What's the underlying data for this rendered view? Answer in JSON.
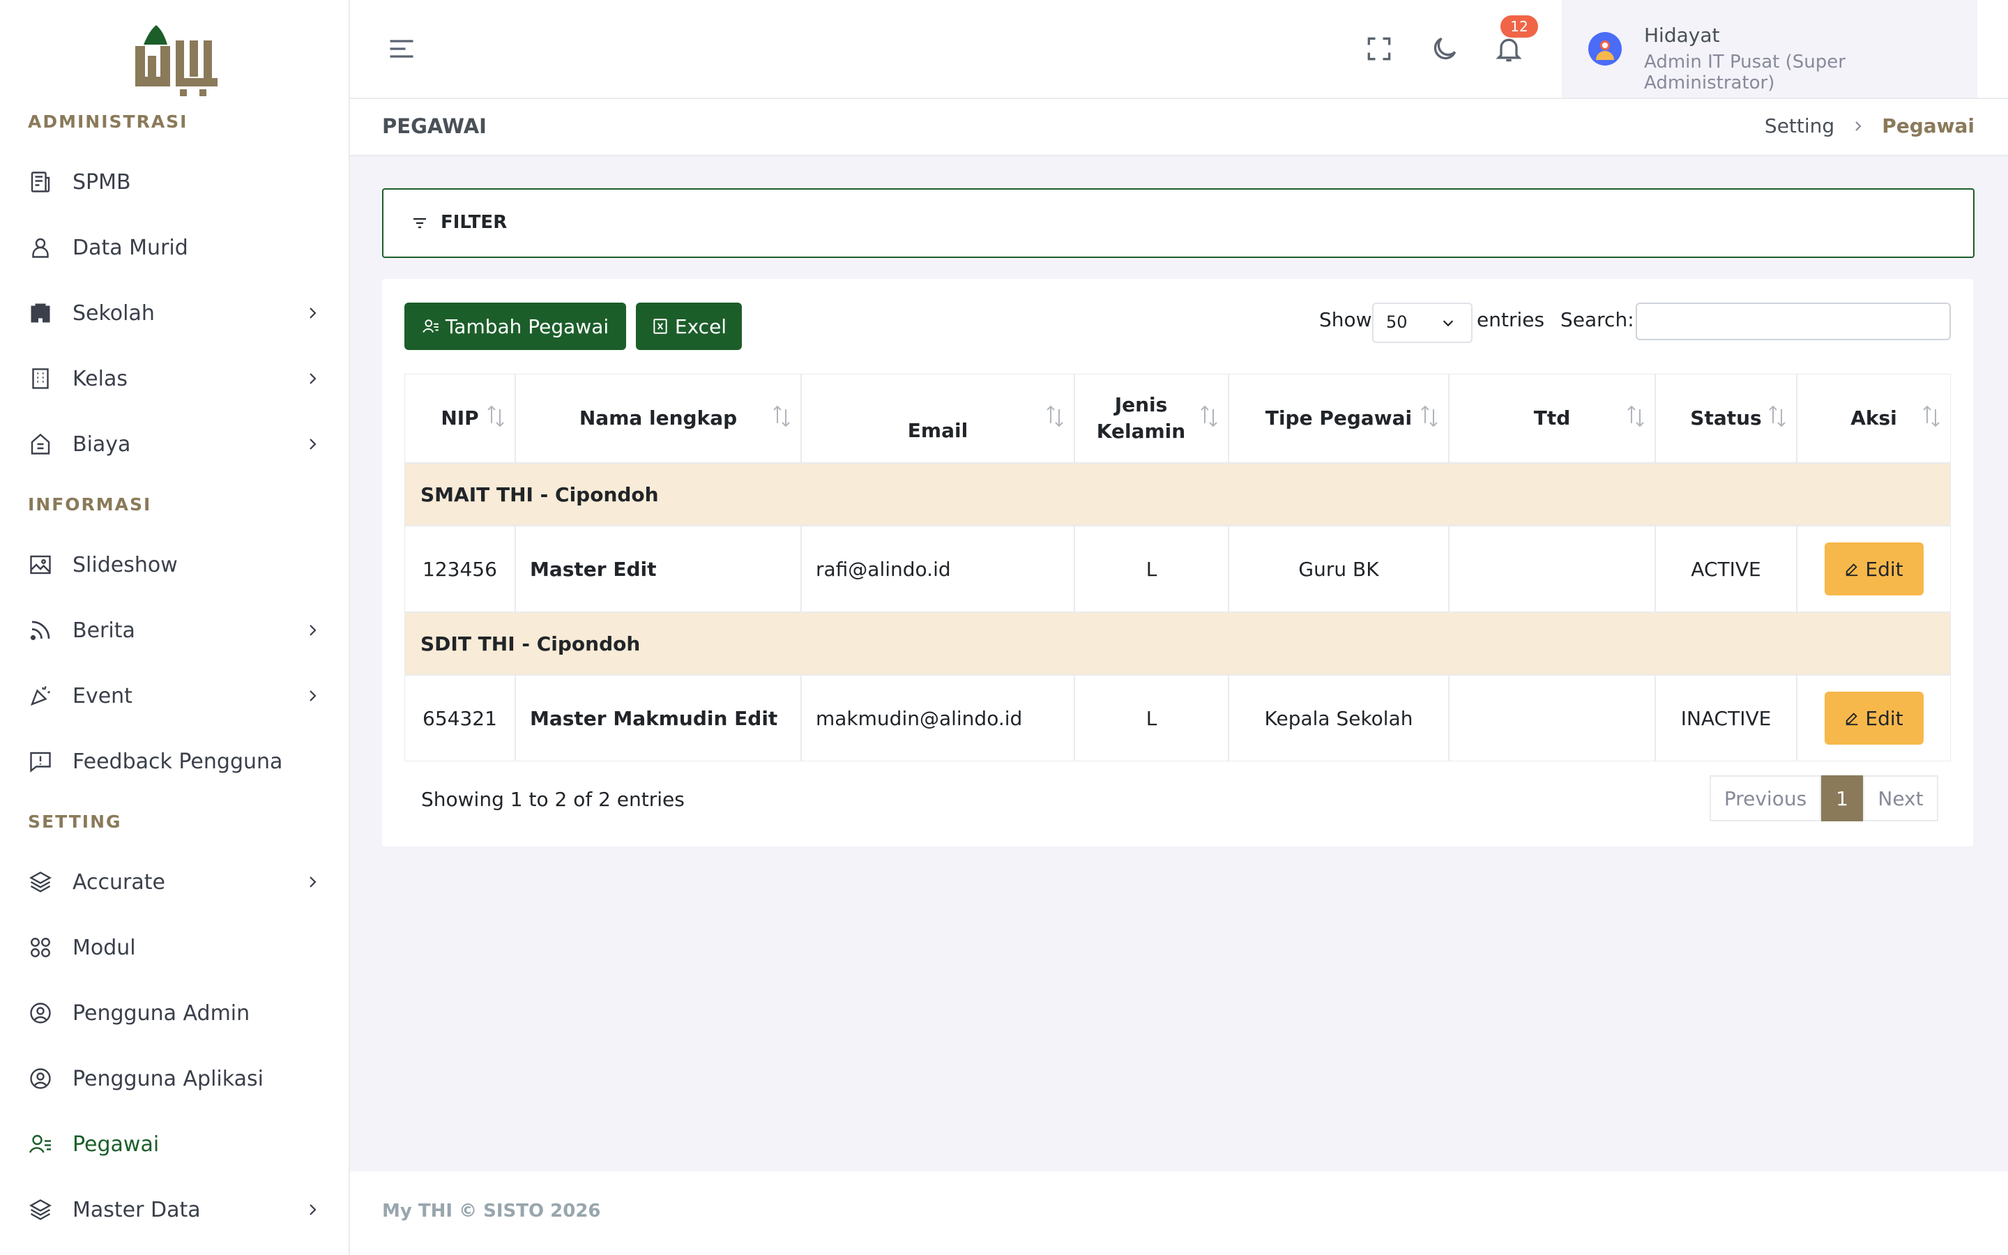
{
  "sidebar": {
    "sections": [
      "ADMINISTRASI",
      "INFORMASI",
      "SETTING"
    ],
    "items": [
      {
        "label": "SPMB",
        "icon": "document-list-icon",
        "has_submenu": false
      },
      {
        "label": "Data Murid",
        "icon": "user-icon",
        "has_submenu": false
      },
      {
        "label": "Sekolah",
        "icon": "building-icon",
        "has_submenu": true
      },
      {
        "label": "Kelas",
        "icon": "building-grid-icon",
        "has_submenu": true
      },
      {
        "label": "Biaya",
        "icon": "home-cost-icon",
        "has_submenu": true
      },
      {
        "label": "Slideshow",
        "icon": "image-icon",
        "has_submenu": false
      },
      {
        "label": "Berita",
        "icon": "rss-icon",
        "has_submenu": true
      },
      {
        "label": "Event",
        "icon": "party-icon",
        "has_submenu": true
      },
      {
        "label": "Feedback Pengguna",
        "icon": "feedback-icon",
        "has_submenu": false
      },
      {
        "label": "Accurate",
        "icon": "layers-icon",
        "has_submenu": true
      },
      {
        "label": "Modul",
        "icon": "modules-icon",
        "has_submenu": false
      },
      {
        "label": "Pengguna Admin",
        "icon": "user-circle-icon",
        "has_submenu": false
      },
      {
        "label": "Pengguna Aplikasi",
        "icon": "user-circle-icon",
        "has_submenu": false
      },
      {
        "label": "Pegawai",
        "icon": "user-list-icon",
        "has_submenu": false,
        "active": true
      },
      {
        "label": "Master Data",
        "icon": "layers-icon",
        "has_submenu": true
      }
    ]
  },
  "header": {
    "notification_count": "12",
    "user_name": "Hidayat",
    "user_role": "Admin IT Pusat (Super Administrator)"
  },
  "page": {
    "title": "PEGAWAI",
    "breadcrumb": [
      "Setting",
      "Pegawai"
    ]
  },
  "filter": {
    "label": "FILTER"
  },
  "toolbar": {
    "add_label": "Tambah Pegawai",
    "excel_label": "Excel",
    "show_label": "Show",
    "entries_value": "50",
    "entries_label": "entries",
    "search_label": "Search:",
    "search_value": ""
  },
  "table": {
    "columns": [
      "NIP",
      "Nama lengkap",
      "Email",
      "Jenis Kelamin",
      "Tipe Pegawai",
      "Ttd",
      "Status",
      "Aksi"
    ],
    "groups": [
      {
        "name": "SMAIT THI - Cipondoh",
        "rows": [
          {
            "nip": "123456",
            "nama": "Master Edit",
            "email": "rafi@alindo.id",
            "jk": "L",
            "tipe": "Guru BK",
            "ttd": "",
            "status": "ACTIVE",
            "aksi": "Edit"
          }
        ]
      },
      {
        "name": "SDIT THI - Cipondoh",
        "rows": [
          {
            "nip": "654321",
            "nama": "Master Makmudin Edit",
            "email": "makmudin@alindo.id",
            "jk": "L",
            "tipe": "Kepala Sekolah",
            "ttd": "",
            "status": "INACTIVE",
            "aksi": "Edit"
          }
        ]
      }
    ],
    "info": "Showing 1 to 2 of 2 entries"
  },
  "pagination": {
    "previous": "Previous",
    "current": "1",
    "next": "Next"
  },
  "footer": {
    "text": "My THI © SISTO 2026"
  },
  "colors": {
    "primary_green": "#1c5e2a",
    "brand_brown": "#8a7a5a",
    "group_row_bg": "#f8ebd7",
    "edit_button": "#f7b84b",
    "badge": "#f06548"
  }
}
